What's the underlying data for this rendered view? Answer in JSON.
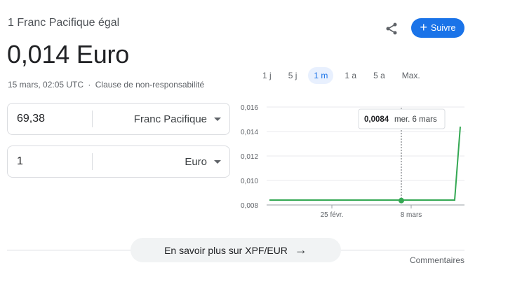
{
  "header": {
    "subtitle": "1 Franc Pacifique égal",
    "rate": "0,014 Euro",
    "timestamp": "15 mars, 02:05 UTC",
    "separator": "·",
    "disclaimer": "Clause de non-responsabilité"
  },
  "actions": {
    "follow_label": "Suivre",
    "follow_plus": "+"
  },
  "converter": {
    "from": {
      "amount": "69,38",
      "currency": "Franc Pacifique"
    },
    "to": {
      "amount": "1",
      "currency": "Euro"
    }
  },
  "range_tabs": [
    "1 j",
    "5 j",
    "1 m",
    "1 a",
    "5 a",
    "Max."
  ],
  "active_range": "1 m",
  "colors": {
    "accent": "#1a73e8",
    "line": "#34a853",
    "grid": "#e8eaed"
  },
  "chart_data": {
    "type": "line",
    "y_ticks": [
      "0,016",
      "0,014",
      "0,012",
      "0,010",
      "0,008"
    ],
    "x_ticks": [
      "25 févr.",
      "8 mars"
    ],
    "ylim": [
      0.008,
      0.016
    ],
    "series": [
      {
        "x": [
          "13 févr.",
          "14 févr.",
          "17 févr.",
          "18 févr.",
          "19 févr.",
          "20 févr.",
          "21 févr.",
          "24 févr.",
          "25 févr.",
          "26 févr.",
          "27 févr.",
          "28 févr.",
          "3 mars",
          "4 mars",
          "5 mars",
          "6 mars",
          "7 mars",
          "10 mars",
          "11 mars",
          "12 mars",
          "13 mars",
          "14 mars",
          "15 mars"
        ],
        "values": [
          0.0084,
          0.0084,
          0.0084,
          0.0084,
          0.0084,
          0.0084,
          0.0084,
          0.0084,
          0.0084,
          0.0084,
          0.0084,
          0.0084,
          0.0084,
          0.0084,
          0.0084,
          0.0084,
          0.0084,
          0.0084,
          0.0084,
          0.0084,
          0.0084,
          0.0084,
          0.0144
        ]
      }
    ],
    "hover": {
      "value": "0,0084",
      "date": "mer. 6 mars"
    }
  },
  "footer": {
    "learn_more": "En savoir plus sur XPF/EUR",
    "arrow": "→",
    "comments": "Commentaires"
  }
}
